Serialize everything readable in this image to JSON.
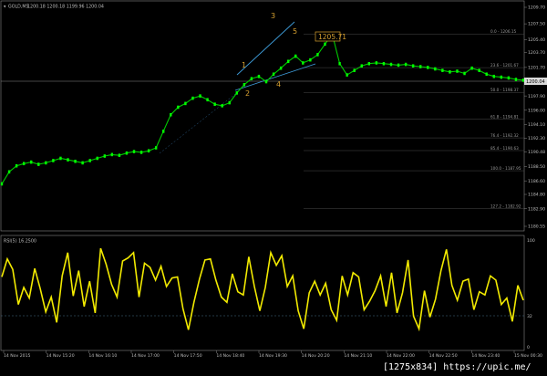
{
  "header": {
    "symbol": "GOLD,M5",
    "quotes": "1200.18 1200.18 1199.96 1200.04"
  },
  "price_axis": {
    "labels": [
      "1209.70",
      "1207.50",
      "1205.40",
      "1203.70",
      "1201.70",
      "1199.68",
      "1197.90",
      "1196.00",
      "1194.10",
      "1192.30",
      "1190.48",
      "1188.50",
      "1186.60",
      "1184.80",
      "1182.90",
      "1180.55"
    ],
    "current_price": "1200.04"
  },
  "fib_levels": [
    "0.0 - 1206.15",
    "23.6 - 1201.67",
    "50.0 - 1198.37",
    "61.8 - 1194.81",
    "76.4 - 1192.32",
    "85.4 - 1190.63",
    "100.0 - 1187.95",
    "127.2 - 1182.92"
  ],
  "fib_value_label": "1205.71",
  "wave_labels": [
    "1",
    "2",
    "3",
    "4",
    "5"
  ],
  "indicator": {
    "title": "RSI(5) 16.2500",
    "scale_top": "100",
    "scale_level": "32",
    "scale_bottom": "0"
  },
  "time_axis": [
    "14 Nov 2015",
    "14 Nov 15:20",
    "14 Nov 16:10",
    "14 Nov 17:00",
    "14 Nov 17:50",
    "14 Nov 18:40",
    "14 Nov 19:30",
    "14 Nov 20:20",
    "14 Nov 21:10",
    "14 Nov 22:00",
    "14 Nov 22:50",
    "14 Nov 23:40",
    "15 Nov 00:30"
  ],
  "watermark": "[1275x834] https://upic.me/",
  "colors": {
    "price": "#00cc00",
    "rsi": "#f2ea00",
    "fib": "#5a5a5a",
    "wave": "#d6a030",
    "channel": "#3d9ad6"
  },
  "chart_data": [
    {
      "type": "line",
      "title": "GOLD,M5",
      "xlabel": "",
      "ylabel": "",
      "ylim": [
        1180.55,
        1209.7
      ],
      "series": [
        {
          "values": [
            1186.2,
            1187.8,
            1188.6,
            1188.9,
            1189.1,
            1188.8,
            1189.0,
            1189.3,
            1189.6,
            1189.4,
            1189.2,
            1189.0,
            1189.3,
            1189.6,
            1189.9,
            1190.1,
            1190.0,
            1190.3,
            1190.5,
            1190.4,
            1190.6,
            1191.0,
            1193.2,
            1195.4,
            1196.4,
            1196.9,
            1197.6,
            1197.9,
            1197.4,
            1196.8,
            1196.6,
            1197.0,
            1198.3,
            1199.4,
            1200.2,
            1200.5,
            1199.8,
            1200.8,
            1201.6,
            1202.5,
            1203.2,
            1202.3,
            1202.7,
            1203.4,
            1204.8,
            1206.1,
            1202.2,
            1200.7,
            1201.3,
            1201.9,
            1202.2,
            1202.3,
            1202.2,
            1202.1,
            1202.0,
            1202.1,
            1201.9,
            1201.8,
            1201.7,
            1201.5,
            1201.3,
            1201.1,
            1201.2,
            1200.9,
            1201.6,
            1201.3,
            1200.8,
            1200.5,
            1200.4,
            1200.3,
            1200.1,
            1200.0
          ]
        }
      ]
    },
    {
      "type": "line",
      "title": "RSI(5) 16.2500",
      "xlabel": "",
      "ylabel": "",
      "ylim": [
        0,
        100
      ],
      "series": [
        {
          "values": [
            66,
            83,
            73,
            40,
            56,
            46,
            74,
            55,
            33,
            47,
            23,
            67,
            89,
            48,
            72,
            38,
            62,
            32,
            93,
            78,
            59,
            47,
            81,
            84,
            89,
            47,
            79,
            75,
            63,
            76,
            57,
            65,
            66,
            36,
            16,
            42,
            64,
            82,
            83,
            63,
            47,
            42,
            69,
            52,
            49,
            85,
            57,
            34,
            56,
            89,
            77,
            86,
            57,
            67,
            34,
            17,
            51,
            62,
            49,
            60,
            35,
            25,
            67,
            49,
            70,
            66,
            35,
            43,
            53,
            67,
            38,
            70,
            32,
            51,
            82,
            29,
            17,
            53,
            28,
            45,
            72,
            92,
            58,
            44,
            62,
            64,
            35,
            52,
            49,
            67,
            63,
            40,
            46,
            24,
            58,
            44
          ]
        }
      ]
    }
  ]
}
